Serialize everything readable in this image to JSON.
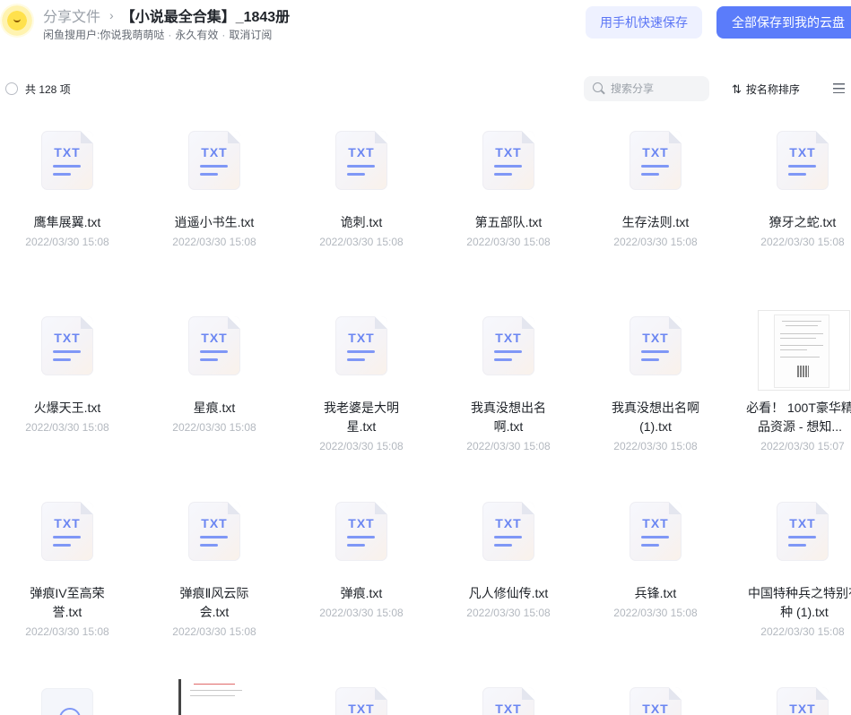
{
  "header": {
    "crumb_root": "分享文件",
    "crumb_sep": "›",
    "title": "【小说最全合集】_1843册",
    "sharer": "闲鱼搜用户:你说我萌萌哒",
    "validity": "永久有效",
    "cancel_label": "取消订阅",
    "dot": "·",
    "phone_save_label": "用手机快速保存",
    "save_all_label": "全部保存到我的云盘"
  },
  "toolbar": {
    "count_label": "共 128 项",
    "search_placeholder": "搜索分享",
    "sort_label": "按名称排序",
    "sort_glyph": "⇅"
  },
  "file_icon_label": "TXT",
  "files": [
    {
      "name": "鹰隼展翼.txt",
      "time": "2022/03/30 15:08"
    },
    {
      "name": "逍遥小书生.txt",
      "time": "2022/03/30 15:08"
    },
    {
      "name": "诡刺.txt",
      "time": "2022/03/30 15:08"
    },
    {
      "name": "第五部队.txt",
      "time": "2022/03/30 15:08"
    },
    {
      "name": "生存法则.txt",
      "time": "2022/03/30 15:08"
    },
    {
      "name": "獠牙之蛇.txt",
      "time": "2022/03/30 15:08"
    },
    {
      "name": "火爆天王.txt",
      "time": "2022/03/30 15:08"
    },
    {
      "name": "星痕.txt",
      "time": "2022/03/30 15:08"
    },
    {
      "name": "我老婆是大明星.txt",
      "time": "2022/03/30 15:08"
    },
    {
      "name": "我真没想出名啊.txt",
      "time": "2022/03/30 15:08"
    },
    {
      "name": "我真没想出名啊(1).txt",
      "time": "2022/03/30 15:08"
    },
    {
      "name": "必看！ 100T豪华精品资源 - 想知...",
      "time": "2022/03/30 15:07"
    },
    {
      "name": "弹痕IV至高荣誉.txt",
      "time": "2022/03/30 15:08"
    },
    {
      "name": "弹痕Ⅱ风云际会.txt",
      "time": "2022/03/30 15:08"
    },
    {
      "name": "弹痕.txt",
      "time": "2022/03/30 15:08"
    },
    {
      "name": "凡人修仙传.txt",
      "time": "2022/03/30 15:08"
    },
    {
      "name": "兵锋.txt",
      "time": "2022/03/30 15:08"
    },
    {
      "name": "中国特种兵之特别有种 (1).txt",
      "time": "2022/03/30 15:08"
    }
  ]
}
